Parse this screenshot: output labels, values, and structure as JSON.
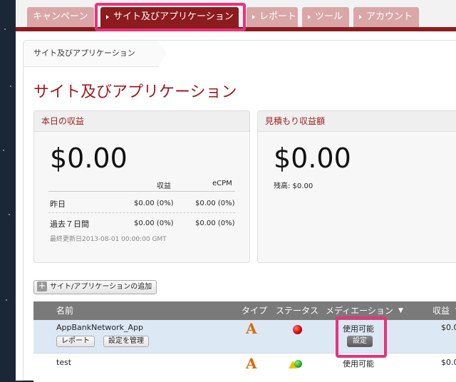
{
  "tabs": [
    {
      "label": "キャンペーン",
      "arrow": false,
      "active": false
    },
    {
      "label": "サイト及びアプリケーション",
      "arrow": true,
      "active": true
    },
    {
      "label": "レポート",
      "arrow": true,
      "active": false
    },
    {
      "label": "ツール",
      "arrow": true,
      "active": false
    },
    {
      "label": "アカウント",
      "arrow": true,
      "active": false
    }
  ],
  "breadcrumb": "サイト及びアプリケーション",
  "page_title": "サイト及びアプリケーション",
  "today": {
    "title": "本日の収益",
    "amount": "$0.00",
    "col_revenue": "収益",
    "col_ecpm": "eCPM",
    "rows": [
      {
        "label": "昨日",
        "revenue": "$0.00 (0%)",
        "ecpm": "$0.00 (0%)"
      },
      {
        "label": "過去７日間",
        "revenue": "$0.00 (0%)",
        "ecpm": "$0.00 (0%)"
      }
    ],
    "updated": "最終更新日2013-08-01 00:00:00 GMT"
  },
  "estimate": {
    "title": "見積もり収益額",
    "amount": "$0.00",
    "balance": "残高: $0.00"
  },
  "add_button": "サイト/アプリケーションの追加",
  "table": {
    "headers": {
      "name": "名前",
      "type": "タイプ",
      "status": "ステータス",
      "mediation": "メディエーション",
      "revenue": "収益"
    },
    "rows": [
      {
        "name": "AppBankNetwork_App",
        "report_btn": "レポート",
        "manage_btn": "設定を管理",
        "mediation": "使用可能",
        "mediation_btn": "設定",
        "revenue": "$0.0"
      },
      {
        "name": "test",
        "mediation": "使用可能",
        "revenue": "$0.0"
      }
    ]
  },
  "colors": {
    "accent": "#8c1b1e",
    "highlight": "#e8337a",
    "tab_inactive": "#d9a7a7"
  }
}
